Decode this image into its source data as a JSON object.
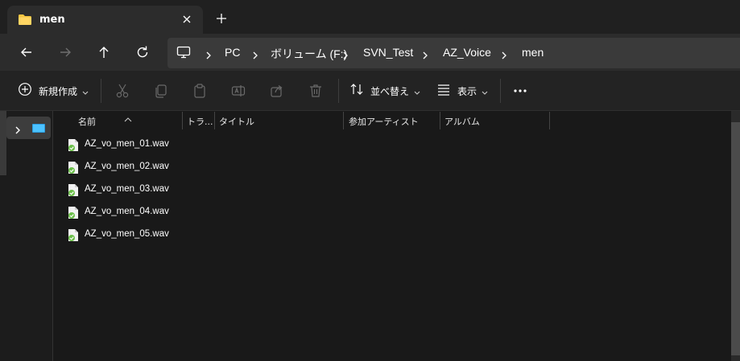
{
  "window": {
    "tab_title": "men",
    "tab_close": "×",
    "new_tab": "+"
  },
  "nav": {
    "back": "back-arrow-icon",
    "forward": "forward-arrow-icon",
    "up": "up-arrow-icon",
    "refresh": "refresh-icon"
  },
  "address": {
    "crumbs": [
      "PC",
      "ボリューム (F:)",
      "SVN_Test",
      "AZ_Voice",
      "men"
    ]
  },
  "commands": {
    "new_label": "新規作成",
    "sort_label": "並べ替え",
    "view_label": "表示",
    "more": "..."
  },
  "columns": {
    "name": "名前",
    "track": "トラ...",
    "title": "タイトル",
    "artist": "参加アーティスト",
    "album": "アルバム"
  },
  "files": [
    "AZ_vo_men_01.wav",
    "AZ_vo_men_02.wav",
    "AZ_vo_men_03.wav",
    "AZ_vo_men_04.wav",
    "AZ_vo_men_05.wav"
  ],
  "colors": {
    "folder": "#f5c542",
    "accent_icon": "#4cc2ff",
    "file_icon_green": "#6cc04a"
  }
}
